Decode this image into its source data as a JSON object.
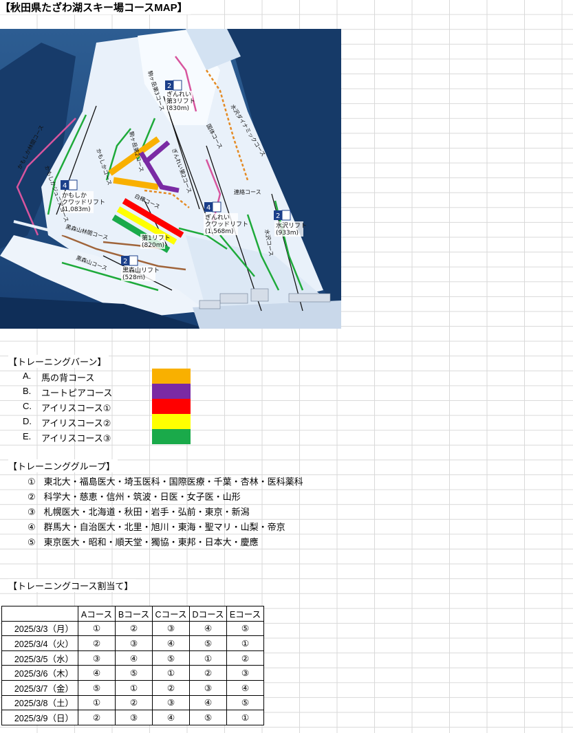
{
  "title": "【秋田県たざわ湖スキー場コースMAP】",
  "map": {
    "labels": {
      "lift_a_num": "2",
      "lift_a_name": "ぎんれい",
      "lift_a_sub": "第3リフト",
      "lift_a_len": "(830m)",
      "lift_b_num": "4",
      "lift_b_name": "かもしか",
      "lift_b_sub": "クワッドリフト",
      "lift_b_len": "(1,083m)",
      "lift_c_num": "4",
      "lift_c_name": "ぎんれい",
      "lift_c_sub": "クワッドリフト",
      "lift_c_len": "(1,568m)",
      "lift_d_num": "2",
      "lift_d_name": "水沢リフト",
      "lift_d_len": "(933m)",
      "lift_e_num": "2",
      "lift_e_name": "黒森山リフト",
      "lift_e_len": "(528m)",
      "lift_f_name": "第1リフト",
      "lift_f_len": "(820m)",
      "course_1": "駒ヶ岳第3コース",
      "course_2": "国体コース",
      "course_3": "水沢ダイナミックコース",
      "course_4": "かもしか林間コース",
      "course_5": "かもしかジュニアコース",
      "course_6": "かもしかコース",
      "course_7": "駒ヶ岳第2コース",
      "course_8": "ぎんれい第2コース",
      "course_9": "連絡コース",
      "course_10": "水沢コース",
      "course_11": "黒森山林間コース",
      "course_12": "黒森山コース",
      "course_13": "白樺コース"
    }
  },
  "lanes": {
    "heading": "【トレーニングバーン】",
    "items": [
      {
        "key": "A.",
        "name": "馬の背コース",
        "color": "#f9b000"
      },
      {
        "key": "B.",
        "name": "ユートピアコース",
        "color": "#7a2aa4"
      },
      {
        "key": "C.",
        "name": "アイリスコース①",
        "color": "#ff0000"
      },
      {
        "key": "D.",
        "name": "アイリスコース②",
        "color": "#ffff00"
      },
      {
        "key": "E.",
        "name": "アイリスコース③",
        "color": "#1aaa4a"
      }
    ]
  },
  "groups": {
    "heading": "【トレーニンググループ】",
    "items": [
      {
        "num": "①",
        "members": "東北大・福島医大・埼玉医科・国際医療・千葉・杏林・医科薬科"
      },
      {
        "num": "②",
        "members": "科学大・慈恵・信州・筑波・日医・女子医・山形"
      },
      {
        "num": "③",
        "members": "札幌医大・北海道・秋田・岩手・弘前・東京・新潟"
      },
      {
        "num": "④",
        "members": "群馬大・自治医大・北里・旭川・東海・聖マリ・山梨・帝京"
      },
      {
        "num": "⑤",
        "members": "東京医大・昭和・順天堂・獨協・東邦・日本大・慶應"
      }
    ]
  },
  "assignment": {
    "heading": "【トレーニングコース割当て】",
    "columns": [
      "",
      "Aコース",
      "Bコース",
      "Cコース",
      "Dコース",
      "Eコース"
    ],
    "rows": [
      {
        "date": "2025/3/3（月）",
        "values": [
          "①",
          "②",
          "③",
          "④",
          "⑤"
        ]
      },
      {
        "date": "2025/3/4（火）",
        "values": [
          "②",
          "③",
          "④",
          "⑤",
          "①"
        ]
      },
      {
        "date": "2025/3/5（水）",
        "values": [
          "③",
          "④",
          "⑤",
          "①",
          "②"
        ]
      },
      {
        "date": "2025/3/6（木）",
        "values": [
          "④",
          "⑤",
          "①",
          "②",
          "③"
        ]
      },
      {
        "date": "2025/3/7（金）",
        "values": [
          "⑤",
          "①",
          "②",
          "③",
          "④"
        ]
      },
      {
        "date": "2025/3/8（土）",
        "values": [
          "①",
          "②",
          "③",
          "④",
          "⑤"
        ]
      },
      {
        "date": "2025/3/9（日）",
        "values": [
          "②",
          "③",
          "④",
          "⑤",
          "①"
        ]
      }
    ]
  }
}
